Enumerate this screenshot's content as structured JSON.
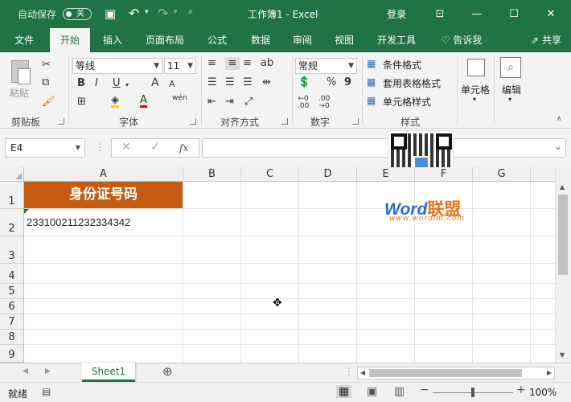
{
  "titlebar": {
    "autosave_label": "自动保存",
    "autosave_state": "关",
    "doc_title": "工作簿1 - Excel",
    "login_label": "登录"
  },
  "tabs": [
    {
      "label": "文件"
    },
    {
      "label": "开始"
    },
    {
      "label": "插入"
    },
    {
      "label": "页面布局"
    },
    {
      "label": "公式"
    },
    {
      "label": "数据"
    },
    {
      "label": "审阅"
    },
    {
      "label": "视图"
    },
    {
      "label": "开发工具"
    }
  ],
  "tell_me": "告诉我",
  "share": "共享",
  "ribbon": {
    "clipboard": {
      "paste_label": "粘贴",
      "group_label": "剪贴板"
    },
    "font": {
      "font_name": "等线",
      "font_size": "11",
      "group_label": "字体",
      "bold": "B",
      "italic": "I",
      "underline": "U",
      "grow": "A",
      "shrink": "A",
      "wen": "wén"
    },
    "alignment": {
      "group_label": "对齐方式"
    },
    "number": {
      "format": "常规",
      "group_label": "数字",
      "percent": "%",
      "comma": "9"
    },
    "styles": {
      "conditional": "条件格式",
      "table": "套用表格格式",
      "cell_style": "单元格样式",
      "group_label": "样式"
    },
    "cells": {
      "label": "单元格"
    },
    "editing": {
      "label": "编辑"
    }
  },
  "formula_bar": {
    "name_box": "E4",
    "fx": "fx",
    "formula": ""
  },
  "grid": {
    "columns": [
      "A",
      "B",
      "C",
      "D",
      "E",
      "F",
      "G"
    ],
    "rows": [
      "1",
      "2",
      "3",
      "4",
      "5",
      "6",
      "7",
      "8",
      "9"
    ],
    "a1": "身份证号码",
    "a2": "233100211232334342",
    "header_fill": "#c55a11"
  },
  "watermark": {
    "brand_word": "Word",
    "brand_cn": "联盟",
    "url": "www.wordlm.com"
  },
  "sheet": {
    "tab_name": "Sheet1"
  },
  "status": {
    "ready": "就绪",
    "zoom": "100%"
  },
  "colors": {
    "accent": "#217346"
  }
}
